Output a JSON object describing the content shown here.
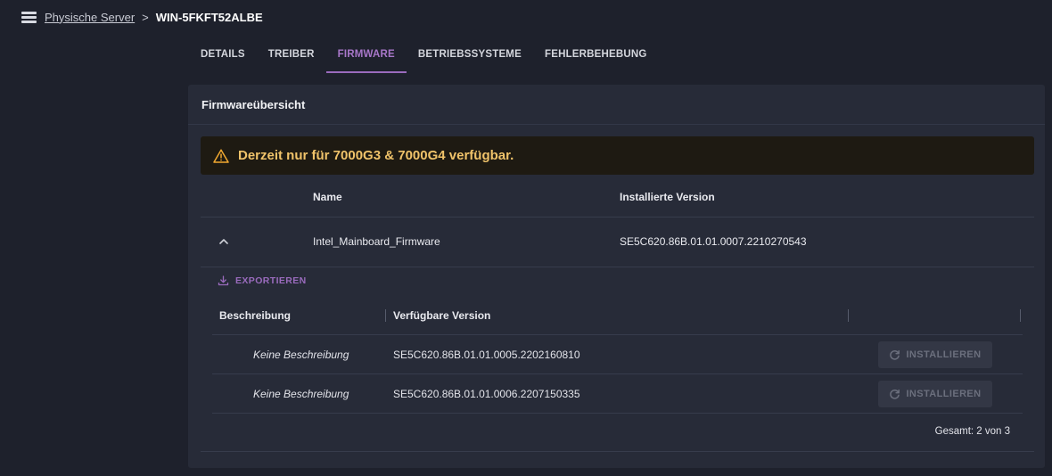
{
  "breadcrumb": {
    "icon": "menu-list-icon",
    "parent": "Physische Server",
    "separator": ">",
    "current": "WIN-5FKFT52ALBE"
  },
  "tabs": [
    {
      "label": "DETAILS",
      "active": false
    },
    {
      "label": "TREIBER",
      "active": false
    },
    {
      "label": "FIRMWARE",
      "active": true
    },
    {
      "label": "BETRIEBSSYSTEME",
      "active": false
    },
    {
      "label": "FEHLERBEHEBUNG",
      "active": false
    }
  ],
  "card": {
    "title": "Firmwareübersicht",
    "warning": {
      "icon": "warning-triangle-icon",
      "text": "Derzeit nur für 7000G3 & 7000G4 verfügbar."
    },
    "table": {
      "headers": {
        "name": "Name",
        "version": "Installierte Version"
      },
      "rows": [
        {
          "name": "Intel_Mainboard_Firmware",
          "version": "SE5C620.86B.01.01.0007.2210270543",
          "expanded": true
        }
      ]
    },
    "export_label": "EXPORTIEREN",
    "subtable": {
      "headers": {
        "description": "Beschreibung",
        "available_version": "Verfügbare Version"
      },
      "rows": [
        {
          "description": "Keine Beschreibung",
          "version": "SE5C620.86B.01.01.0005.2202160810",
          "action": "INSTALLIEREN"
        },
        {
          "description": "Keine Beschreibung",
          "version": "SE5C620.86B.01.01.0006.2207150335",
          "action": "INSTALLIEREN"
        }
      ],
      "pager": "Gesamt: 2 von 3"
    }
  },
  "colors": {
    "background": "#1e212c",
    "card": "#272b38",
    "accent": "#9a6bbd",
    "warning_text": "#f0c36a",
    "warning_bg": "#1e1a12"
  }
}
